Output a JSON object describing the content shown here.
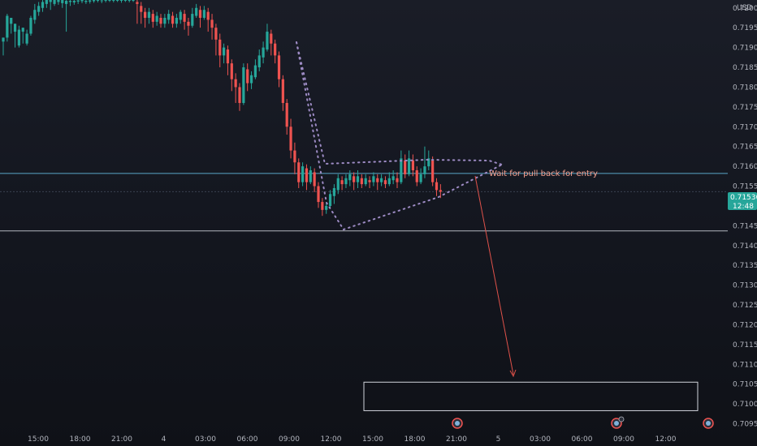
{
  "chart_data": {
    "type": "candlestick",
    "currency_label": "USD",
    "y_ticks": [
      "0.72000",
      "0.71950",
      "0.71900",
      "0.71850",
      "0.71800",
      "0.71750",
      "0.71700",
      "0.71650",
      "0.71600",
      "0.71550",
      "0.71500",
      "0.71450",
      "0.71400",
      "0.71350",
      "0.71300",
      "0.71250",
      "0.71200",
      "0.71150",
      "0.71100",
      "0.71050",
      "0.71000",
      "0.70950"
    ],
    "x_ticks": [
      "15:00",
      "18:00",
      "21:00",
      "4",
      "03:00",
      "06:00",
      "09:00",
      "12:00",
      "15:00",
      "18:00",
      "21:00",
      "5",
      "03:00",
      "06:00",
      "09:00",
      "12:00"
    ],
    "ylim": [
      0.70945,
      0.7202
    ],
    "current_price": "0.71536",
    "countdown": "12:48",
    "horizontal_lines": [
      {
        "name": "resistance",
        "price": 0.71582,
        "color": "#5aa7c9"
      },
      {
        "name": "support",
        "price": 0.71437,
        "color": "#b2b5be"
      }
    ],
    "annotation": "Wait for pull back for entry",
    "target_zone": {
      "from_price": 0.71055,
      "to_price": 0.70983
    },
    "colors": {
      "up": "#26a69a",
      "down": "#ef5350",
      "annotation": "#f7a08f",
      "price_tag": "#26a69a"
    },
    "candles": [
      [
        0.71915,
        0.71925,
        0.7188,
        0.7187
      ],
      [
        0.71925,
        0.7198,
        0.71915,
        0.71985
      ],
      [
        0.7196,
        0.71975,
        0.71935,
        0.71945
      ],
      [
        0.7194,
        0.7196,
        0.719,
        0.71895
      ],
      [
        0.71905,
        0.71945,
        0.719,
        0.71955
      ],
      [
        0.7194,
        0.7195,
        0.7191,
        0.71905
      ],
      [
        0.7191,
        0.71935,
        0.71905,
        0.71945
      ],
      [
        0.71935,
        0.71975,
        0.7193,
        0.7198
      ],
      [
        0.7197,
        0.71995,
        0.7196,
        0.7201
      ],
      [
        0.7199,
        0.72005,
        0.7198,
        0.72015
      ],
      [
        0.72,
        0.72015,
        0.7199,
        0.7202
      ],
      [
        0.7201,
        0.7202,
        0.72,
        0.7202
      ],
      [
        0.72015,
        0.7202,
        0.71995,
        0.7202
      ],
      [
        0.7201,
        0.7202,
        0.72005,
        0.7202
      ],
      [
        0.72015,
        0.7202,
        0.72008,
        0.7202
      ],
      [
        0.72012,
        0.7202,
        0.72,
        0.7202
      ],
      [
        0.7201,
        0.72018,
        0.7194,
        0.7202
      ],
      [
        0.72015,
        0.72018,
        0.72005,
        0.7202
      ],
      [
        0.72014,
        0.72018,
        0.72008,
        0.7202
      ],
      [
        0.72016,
        0.72019,
        0.7201,
        0.7202
      ],
      [
        0.72017,
        0.7202,
        0.72012,
        0.7202
      ],
      [
        0.72015,
        0.72018,
        0.7201,
        0.7202
      ],
      [
        0.72016,
        0.72019,
        0.72011,
        0.7202
      ],
      [
        0.72017,
        0.7202,
        0.72013,
        0.7202
      ],
      [
        0.72018,
        0.7202,
        0.72014,
        0.7202
      ],
      [
        0.72017,
        0.72019,
        0.72012,
        0.7202
      ],
      [
        0.72018,
        0.7202,
        0.72014,
        0.7202
      ],
      [
        0.72019,
        0.7202,
        0.72015,
        0.7202
      ],
      [
        0.72018,
        0.7202,
        0.72014,
        0.7202
      ],
      [
        0.72019,
        0.7202,
        0.72015,
        0.7202
      ],
      [
        0.72018,
        0.7202,
        0.72013,
        0.7202
      ],
      [
        0.72019,
        0.7202,
        0.72015,
        0.7202
      ],
      [
        0.72018,
        0.7202,
        0.72014,
        0.7202
      ],
      [
        0.72019,
        0.7202,
        0.72015,
        0.7202
      ],
      [
        0.72015,
        0.7201,
        0.7196,
        0.7202
      ],
      [
        0.72005,
        0.7199,
        0.7196,
        0.72015
      ],
      [
        0.7199,
        0.71975,
        0.7195,
        0.72
      ],
      [
        0.71975,
        0.7199,
        0.7196,
        0.72
      ],
      [
        0.71985,
        0.71965,
        0.7195,
        0.71995
      ],
      [
        0.71965,
        0.7198,
        0.71955,
        0.7199
      ],
      [
        0.71975,
        0.7196,
        0.7195,
        0.71985
      ],
      [
        0.7196,
        0.71975,
        0.7195,
        0.71985
      ],
      [
        0.7197,
        0.71985,
        0.7196,
        0.71995
      ],
      [
        0.7198,
        0.7196,
        0.7195,
        0.7199
      ],
      [
        0.7196,
        0.71975,
        0.7195,
        0.71985
      ],
      [
        0.7197,
        0.7199,
        0.7196,
        0.71995
      ],
      [
        0.71985,
        0.71965,
        0.71945,
        0.71995
      ],
      [
        0.71965,
        0.71955,
        0.7193,
        0.71975
      ],
      [
        0.71955,
        0.71985,
        0.7195,
        0.72
      ],
      [
        0.7198,
        0.72,
        0.71975,
        0.7201
      ],
      [
        0.71995,
        0.71975,
        0.7195,
        0.72005
      ],
      [
        0.71975,
        0.71995,
        0.7197,
        0.72005
      ],
      [
        0.7199,
        0.7197,
        0.7194,
        0.72
      ],
      [
        0.7197,
        0.7195,
        0.7192,
        0.71985
      ],
      [
        0.7195,
        0.7192,
        0.7188,
        0.7196
      ],
      [
        0.7192,
        0.7188,
        0.7185,
        0.71935
      ],
      [
        0.7188,
        0.719,
        0.7186,
        0.7191
      ],
      [
        0.71895,
        0.7186,
        0.7183,
        0.71905
      ],
      [
        0.7186,
        0.7182,
        0.7179,
        0.7187
      ],
      [
        0.7182,
        0.718,
        0.7176,
        0.71835
      ],
      [
        0.718,
        0.7176,
        0.7174,
        0.7181
      ],
      [
        0.7176,
        0.7185,
        0.71755,
        0.7186
      ],
      [
        0.71845,
        0.7181,
        0.7179,
        0.7186
      ],
      [
        0.7181,
        0.7183,
        0.71795,
        0.7184
      ],
      [
        0.71825,
        0.71855,
        0.7182,
        0.7187
      ],
      [
        0.7185,
        0.7188,
        0.7184,
        0.71895
      ],
      [
        0.71875,
        0.719,
        0.7186,
        0.71915
      ],
      [
        0.71895,
        0.7194,
        0.7189,
        0.7196
      ],
      [
        0.71935,
        0.7191,
        0.7188,
        0.71945
      ],
      [
        0.7191,
        0.7188,
        0.7186,
        0.7192
      ],
      [
        0.7188,
        0.7182,
        0.718,
        0.7189
      ],
      [
        0.7182,
        0.7176,
        0.7174,
        0.7183
      ],
      [
        0.7176,
        0.717,
        0.7168,
        0.7177
      ],
      [
        0.717,
        0.7164,
        0.7162,
        0.7172
      ],
      [
        0.7164,
        0.7161,
        0.7158,
        0.7166
      ],
      [
        0.7161,
        0.7156,
        0.71545,
        0.7162
      ],
      [
        0.7156,
        0.716,
        0.7155,
        0.7161
      ],
      [
        0.71595,
        0.7156,
        0.7154,
        0.71605
      ],
      [
        0.7156,
        0.7159,
        0.71555,
        0.716
      ],
      [
        0.71585,
        0.7155,
        0.71535,
        0.71595
      ],
      [
        0.7155,
        0.7151,
        0.71495,
        0.7156
      ],
      [
        0.7151,
        0.7149,
        0.71475,
        0.7152
      ],
      [
        0.7149,
        0.715,
        0.7148,
        0.7151
      ],
      [
        0.715,
        0.7153,
        0.71495,
        0.7154
      ],
      [
        0.71525,
        0.71545,
        0.71505,
        0.71555
      ],
      [
        0.7154,
        0.7157,
        0.7153,
        0.7158
      ],
      [
        0.71565,
        0.71555,
        0.7154,
        0.71575
      ],
      [
        0.71555,
        0.7157,
        0.71545,
        0.7158
      ],
      [
        0.71565,
        0.7158,
        0.7155,
        0.7159
      ],
      [
        0.71575,
        0.7156,
        0.7154,
        0.71585
      ],
      [
        0.7156,
        0.71575,
        0.71545,
        0.7159
      ],
      [
        0.7157,
        0.71555,
        0.71545,
        0.7158
      ],
      [
        0.71555,
        0.7157,
        0.7155,
        0.7158
      ],
      [
        0.71565,
        0.7156,
        0.71545,
        0.71575
      ],
      [
        0.7156,
        0.71575,
        0.7155,
        0.71585
      ],
      [
        0.7157,
        0.7156,
        0.7154,
        0.7158
      ],
      [
        0.7156,
        0.7157,
        0.7155,
        0.7158
      ],
      [
        0.71565,
        0.71555,
        0.71545,
        0.71575
      ],
      [
        0.71555,
        0.7157,
        0.7155,
        0.71585
      ],
      [
        0.71565,
        0.71575,
        0.71555,
        0.7159
      ],
      [
        0.7157,
        0.7156,
        0.71545,
        0.71585
      ],
      [
        0.7156,
        0.7162,
        0.71555,
        0.7164
      ],
      [
        0.71615,
        0.7158,
        0.7157,
        0.7163
      ],
      [
        0.7158,
        0.7162,
        0.71575,
        0.7164
      ],
      [
        0.71615,
        0.7159,
        0.71575,
        0.7163
      ],
      [
        0.7159,
        0.7156,
        0.7155,
        0.716
      ],
      [
        0.7156,
        0.7158,
        0.71555,
        0.71595
      ],
      [
        0.7158,
        0.716,
        0.7157,
        0.7165
      ],
      [
        0.716,
        0.7162,
        0.7159,
        0.7164
      ],
      [
        0.71615,
        0.7156,
        0.7155,
        0.71625
      ],
      [
        0.7156,
        0.7154,
        0.71525,
        0.7157
      ],
      [
        0.7154,
        0.71536,
        0.7152,
        0.71555
      ]
    ]
  }
}
